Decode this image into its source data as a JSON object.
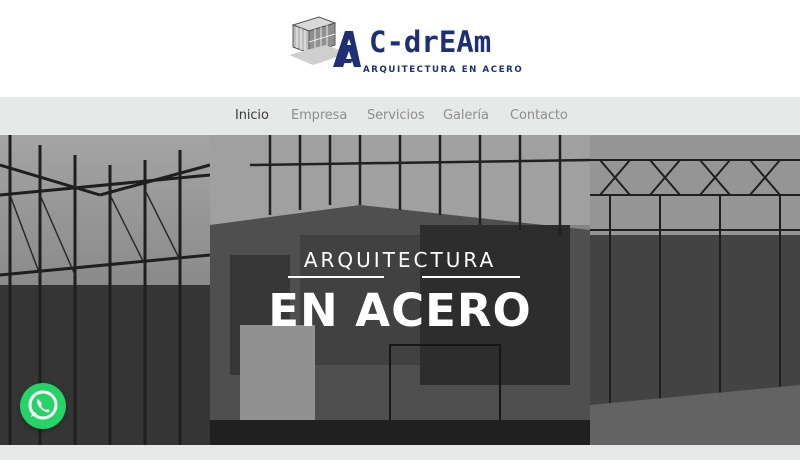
{
  "brand": {
    "name": "C-drEAm",
    "tagline": "ARQUITECTURA EN ACERO",
    "color": "#1e2f73"
  },
  "nav": {
    "items": [
      {
        "label": "Inicio",
        "active": true
      },
      {
        "label": "Empresa",
        "active": false
      },
      {
        "label": "Servicios",
        "active": false
      },
      {
        "label": "Galería",
        "active": false
      },
      {
        "label": "Contacto",
        "active": false
      }
    ]
  },
  "hero": {
    "subtitle": "ARQUITECTURA",
    "title": "EN ACERO"
  },
  "whatsapp": {
    "icon": "whatsapp-icon",
    "color": "#25d366"
  }
}
